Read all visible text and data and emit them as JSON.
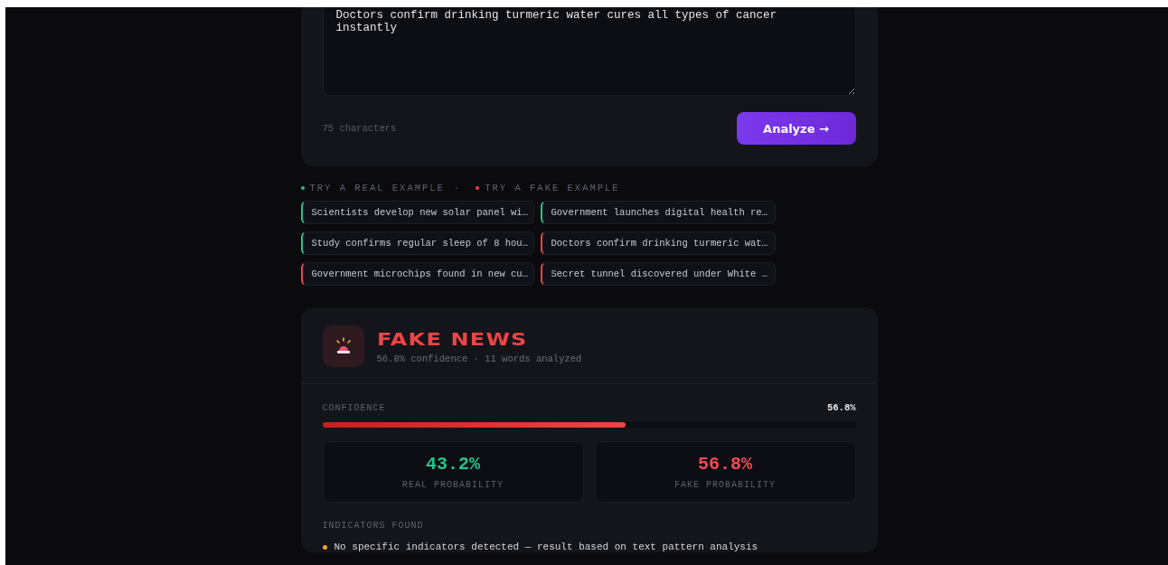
{
  "input": {
    "value": "Doctors confirm drinking turmeric water cures all types of cancer instantly",
    "char_count": "75 characters",
    "button": "Analyze →"
  },
  "examples": {
    "real_label": "TRY A REAL EXAMPLE",
    "separator": "·",
    "fake_label": "TRY A FAKE EXAMPLE",
    "items": [
      {
        "text": "Scientists develop new solar panel wi…",
        "kind": "real"
      },
      {
        "text": "Government launches digital health re…",
        "kind": "real"
      },
      {
        "text": "Study confirms regular sleep of 8 hou…",
        "kind": "real"
      },
      {
        "text": "Doctors confirm drinking turmeric wat…",
        "kind": "fake"
      },
      {
        "text": "Government microchips found in new cu…",
        "kind": "fake"
      },
      {
        "text": "Secret tunnel discovered under White …",
        "kind": "fake"
      }
    ]
  },
  "result": {
    "verdict": "FAKE NEWS",
    "kind": "fake",
    "subtitle": "56.8% confidence · 11 words analyzed",
    "confidence_label": "CONFIDENCE",
    "confidence_value": "56.8%",
    "level": 0.568,
    "stats": [
      {
        "value": "43.2%",
        "label": "REAL PROBABILITY",
        "kind": "real"
      },
      {
        "value": "56.8%",
        "label": "FAKE PROBABILITY",
        "kind": "fake"
      }
    ],
    "indicators_label": "INDICATORS FOUND",
    "indicators": [
      "No specific indicators detected — result based on text pattern analysis"
    ]
  }
}
